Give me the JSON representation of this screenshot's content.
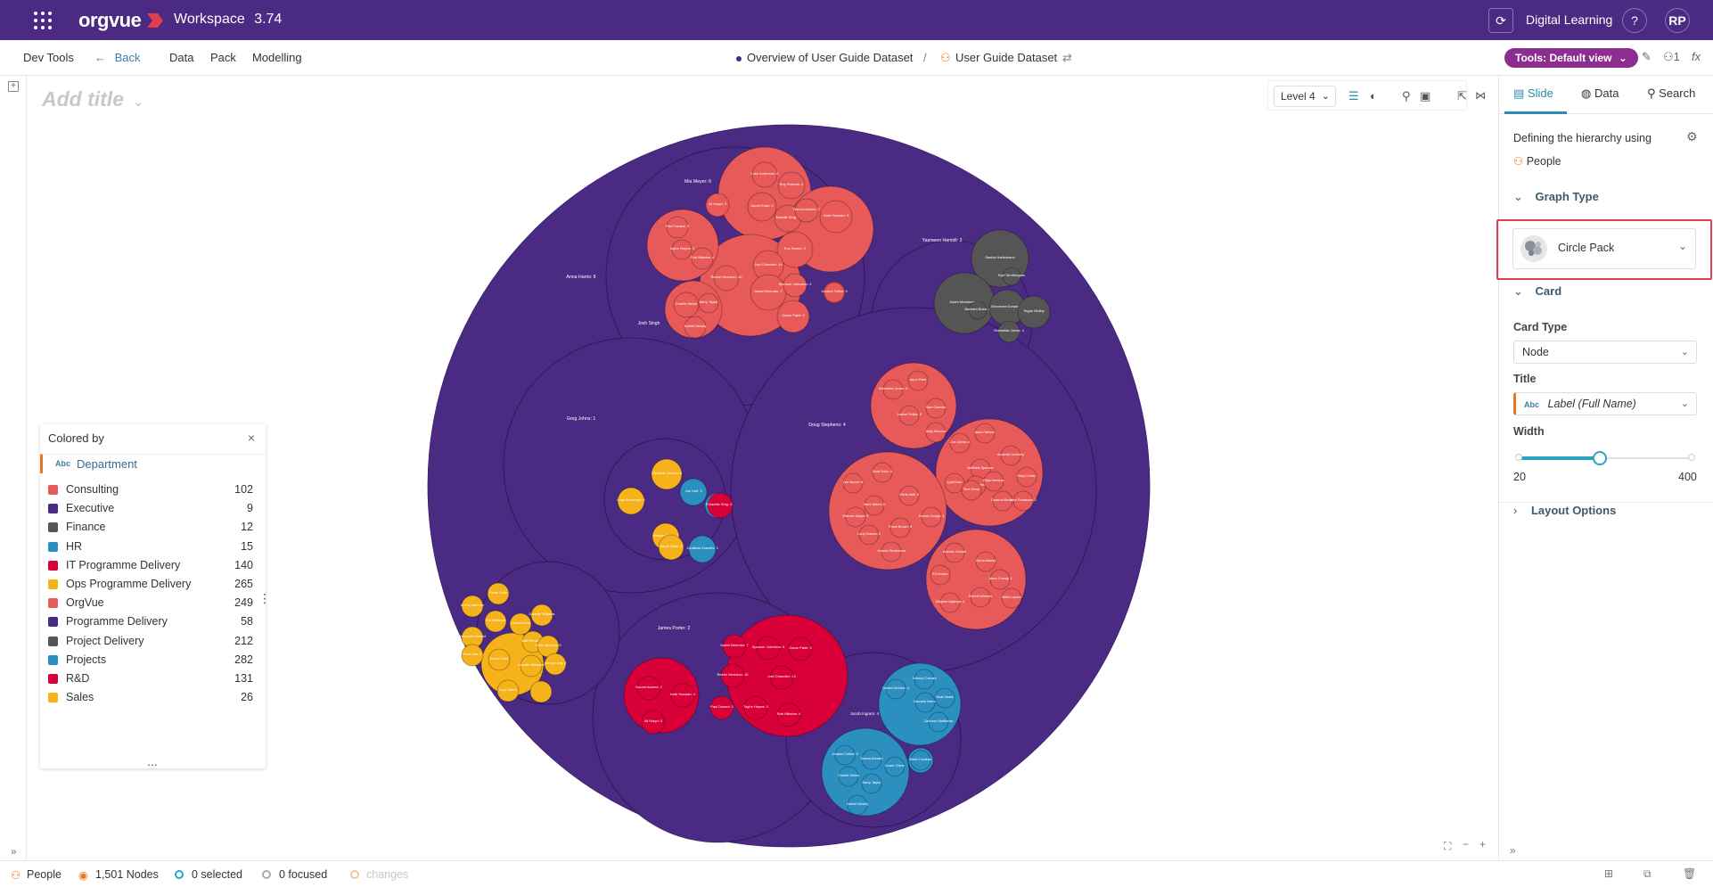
{
  "topbar": {
    "brand": "orgvue",
    "workspace_label": "Workspace",
    "version": "3.74",
    "digital_learning": "Digital Learning",
    "help_label": "?",
    "avatar_initials": "RP"
  },
  "navbar": {
    "dev_tools": "Dev Tools",
    "back": "Back",
    "data": "Data",
    "pack": "Pack",
    "modelling": "Modelling",
    "crumb_1": "Overview of User Guide Dataset",
    "crumb_sep": "/",
    "crumb_2": "User Guide Dataset",
    "tools_button": "Tools: Default view",
    "persona_count": "1",
    "fx_label": "fx"
  },
  "canvas": {
    "add_title": "Add title",
    "level_select": "Level 4",
    "labels": [
      "Mia Meyer: 6",
      "Anna Harris: 8",
      "Yasmeen Hamidi: 3",
      "Greg Johns: 1",
      "Doug Stephens: 4",
      "James Porter: 2",
      "Josh Singh",
      "Christine Jensen: 8",
      "Joe Holt: 3",
      "Nathan Nolan: 2",
      "Jonathan Daniels: 3",
      "Luke Anderson: 6",
      "Roy Roberts: 2",
      "Jacob Khan: 2",
      "Maddie King: 3",
      "Eva Hunter: 2",
      "Naomi Adams: 2",
      "Kate Hussain: 3",
      "Ali Naqvi: 3",
      "Paul Dawes: 3",
      "Taylor Hayes: 3",
      "Rob Mikelos: 4",
      "Reese Morrison: 10",
      "Joel Chandler: 14",
      "Isabel Beeman: 7",
      "Spencer Johnston: 4",
      "Oscar Patel: 3",
      "Jessica Talbot: 5",
      "Charlie Mellor",
      "Barry Taylor",
      "Daniel Moody",
      "Sasha Ahmed",
      "Grace Oliver",
      "Bella Trudeau",
      "Daniel McGee: 4",
      "Johnny Conrad",
      "Kamala Harris",
      "Noah Nash",
      "Zachary Matthews",
      "Jacob Ingram: 4",
      "Archie Norton: 38",
      "Ruby Drake: 15",
      "Andrew Singh: 5",
      "Michael Brothers: 3",
      "Luca Bond: 6",
      "Chelsea Gill: 6",
      "Stefan Jones: 3",
      "Kiko Sanders: 3",
      "Martin Porter",
      "Eric Randall",
      "Santiago Iglesias: 1",
      "Sascha Gonner: 3",
      "Thomas Quintar: 4",
      "Kate Norris: 3",
      "Poppy Buckland: 8",
      "Harrison Flynn: 6",
      "Conner Morton: 8",
      "Gary Rogers",
      "Alex Liu: 2",
      "Grace King",
      "Frank Peterson",
      "Sarah Flynn: 1",
      "Saskia Hadelmann",
      "Kyle Worthington",
      "Adam Meadows: 4",
      "Barbara Bush: 2",
      "Giovanna Dorado: 2",
      "Tegan Mulloy",
      "Sebastian Jones: 4",
      "Arjun Patel",
      "Justine Pellier: 5",
      "Sam Chewan",
      "Sally McLeod",
      "Lee Moore: 8",
      "Scott Delic: 4",
      "Marc Noteri: 5",
      "Olivia Neff: 5",
      "Michael Mayer: 5",
      "Declan Gough: 4",
      "Frank Brown: 5",
      "Larry Dawes: 5",
      "Jessica Smallwood",
      "Adam Nelson",
      "Amanda Donnelly",
      "Matthew Spencer",
      "Mary Oriette",
      "Lyall Daw",
      "Gabriel Newton",
      "Tess Sewn",
      "Rhys Harrison",
      "Deanna Benon",
      "Nico Protassini: 2",
      "Zoe Johns: 6",
      "Antonio Orozak",
      "Sylvia Marley",
      "Eli Hooker",
      "Jason Cheng: 3",
      "Robert Wheeler",
      "Mella Larsen",
      "Meghan Agarwal: 4",
      "Archie Hartman",
      "Sarah Colie",
      "Eva Stillwood",
      "Connie Lima",
      "Danielle Williams",
      "Stephanie Harreid",
      "Sean Lilie: 2",
      "Rossa Fidel",
      "Jodi Fernandez",
      "Chris Sanchez: 8",
      "Jennifer Molanda",
      "Danny Long: 5",
      "Kyla Tallinn"
    ],
    "legend_title": "Colored by",
    "legend_close": "×",
    "legend_field_abc": "Abc",
    "legend_field": "Department",
    "legend_more": "...",
    "legend_grip": "⋮",
    "legend_items": [
      {
        "label": "Consulting",
        "count": "102",
        "color": "#e8595a"
      },
      {
        "label": "Executive",
        "count": "9",
        "color": "#4a2a82"
      },
      {
        "label": "Finance",
        "count": "12",
        "color": "#555555"
      },
      {
        "label": "HR",
        "count": "15",
        "color": "#2b8fc0"
      },
      {
        "label": "IT Programme Delivery",
        "count": "140",
        "color": "#d9003a"
      },
      {
        "label": "Ops Programme Delivery",
        "count": "265",
        "color": "#f6b21b"
      },
      {
        "label": "OrgVue",
        "count": "249",
        "color": "#e8595a"
      },
      {
        "label": "Programme Delivery",
        "count": "58",
        "color": "#4a2a82"
      },
      {
        "label": "Project Delivery",
        "count": "212",
        "color": "#555555"
      },
      {
        "label": "Projects",
        "count": "282",
        "color": "#2b8fc0"
      },
      {
        "label": "R&D",
        "count": "131",
        "color": "#d9003a"
      },
      {
        "label": "Sales",
        "count": "26",
        "color": "#f6b21b"
      }
    ]
  },
  "right_panel": {
    "tab_slide": "Slide",
    "tab_data": "Data",
    "tab_search": "Search",
    "hierarchy_text": "Defining the hierarchy using",
    "hierarchy_value": "People",
    "graph_type_header": "Graph Type",
    "graph_type_value": "Circle Pack",
    "card_header": "Card",
    "card_type_label": "Card Type",
    "card_type_value": "Node",
    "title_label": "Title",
    "title_abc": "Abc",
    "title_value": "Label (Full Name)",
    "width_label": "Width",
    "width_min": "20",
    "width_max": "400",
    "layout_options": "Layout Options"
  },
  "statusbar": {
    "people": "People",
    "nodes": "1,501 Nodes",
    "selected": "0 selected",
    "focused": "0 focused",
    "changes": "changes"
  },
  "colors": {
    "topbar": "#4a2a82",
    "accent": "#2a8ab0",
    "consulting": "#e8595a",
    "finance": "#555555",
    "hr": "#2b8fc0",
    "rnd": "#d9003a",
    "sales": "#f6b21b",
    "highlight": "#e0404e"
  }
}
